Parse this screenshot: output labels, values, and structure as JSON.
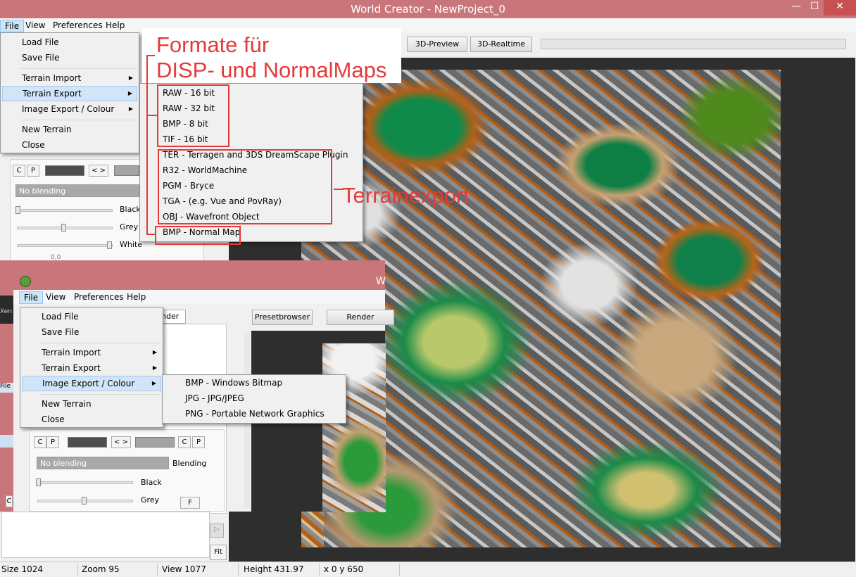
{
  "window": {
    "title": "World Creator -  NewProject_0",
    "minimize": "—",
    "maximize": "☐",
    "close": "✕"
  },
  "menu": {
    "file": "File",
    "view": "View",
    "preferences": "Preferences",
    "help": "Help"
  },
  "toolbar": {
    "preview_3d": "3D-Preview",
    "realtime_3d": "3D-Realtime"
  },
  "file_menu": {
    "load": "Load File",
    "save": "Save File",
    "terrain_import": "Terrain Import",
    "terrain_export": "Terrain Export",
    "image_export": "Image Export / Colour",
    "new_terrain": "New Terrain",
    "close": "Close"
  },
  "terrain_export_submenu": [
    "RAW - 16 bit",
    "RAW - 32 bit",
    "BMP - 8 bit",
    "TIF - 16 bit",
    "TER - Terragen and 3DS DreamScape Plugin",
    "R32 - WorldMachine",
    "PGM - Bryce",
    "TGA - (e.g. Vue and PovRay)",
    "OBJ - Wavefront Object",
    "BMP - Normal Map"
  ],
  "image_export_submenu": [
    "BMP - Windows Bitmap",
    "JPG - JPG/JPEG",
    "PNG - Portable Network Graphics"
  ],
  "annotations": {
    "formats_line1": "Formate für",
    "formats_line2": "DISP- und NormalMaps",
    "terrainexport": "Terrainexport"
  },
  "layer_panel": {
    "c": "C",
    "p": "P",
    "swap": "< >",
    "blend_mode": "No blending",
    "blending_label": "Blending",
    "black": "Black",
    "grey": "Grey",
    "white": "White",
    "f": "F",
    "partial_value": "0,0"
  },
  "win2": {
    "title_partial": "W",
    "tab_partial": "nder",
    "presetbrowser": "Presetbrowser",
    "render": "Render",
    "left_text": "Xen",
    "left_file": "File"
  },
  "side": {
    "fit": "Fit",
    "small_c": "C"
  },
  "status": {
    "size": "Size 1024",
    "zoom": "Zoom  95",
    "view": "View  1077",
    "height": "Height 431.97",
    "coords": "x 0 y 650"
  },
  "colors": {
    "titlebar": "#c9767b",
    "annotation": "#e43a3a",
    "highlight": "#d1e5f8"
  }
}
